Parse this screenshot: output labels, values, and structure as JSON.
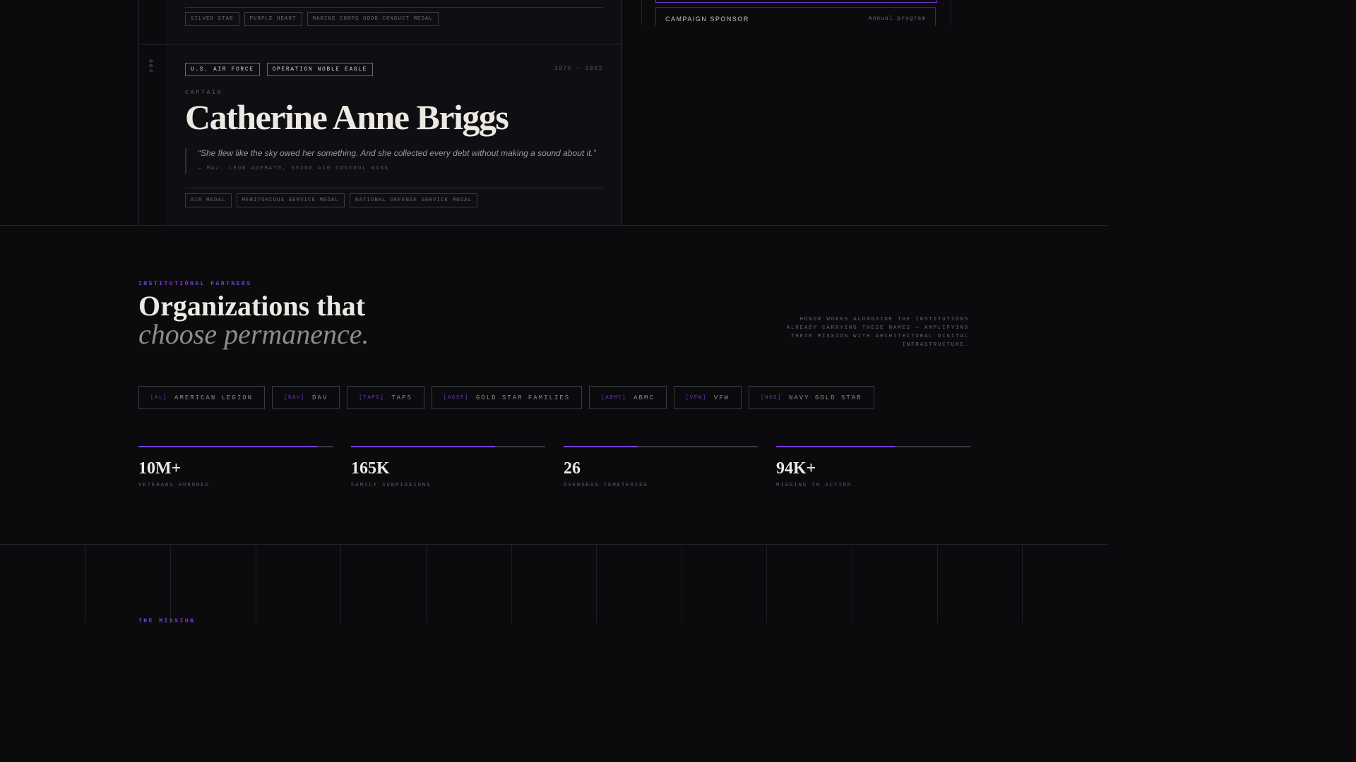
{
  "previous_card": {
    "medals": [
      "SILVER STAR",
      "PURPLE HEART",
      "MARINE CORPS GOOD CONDUCT MEDAL"
    ]
  },
  "sidebar": {
    "sponsor_label": "CAMPAIGN SPONSOR",
    "sponsor_note": "Annual program"
  },
  "memorial": {
    "index": "004",
    "branch": "U.S. AIR FORCE",
    "operation": "OPERATION NOBLE EAGLE",
    "years": "1975 — 2002",
    "rank": "CAPTAIN",
    "name": "Catherine Anne Briggs",
    "quote": "“She flew like the sky owed her something. And she collected every debt without making a sound about it.”",
    "attribution": "— MAJ. LEON ADEBAYO, 552ND AIR CONTROL WING",
    "medals": [
      "AIR MEDAL",
      "MERITORIOUS SERVICE MEDAL",
      "NATIONAL DEFENSE SERVICE MEDAL"
    ]
  },
  "partners": {
    "eyebrow": "INSTITUTIONAL PARTNERS",
    "headline_line1": "Organizations that",
    "headline_line2": "choose permanence.",
    "side_copy": "HONOR WORKS ALONGSIDE THE INSTITUTIONS ALREADY CARRYING THESE NAMES — AMPLIFYING THEIR MISSION WITH ARCHITECTURAL DIGITAL INFRASTRUCTURE.",
    "organizations": [
      {
        "abbr": "[AL]",
        "name": "AMERICAN LEGION"
      },
      {
        "abbr": "[DAV]",
        "name": "DAV"
      },
      {
        "abbr": "[TAPS]",
        "name": "TAPS"
      },
      {
        "abbr": "[AGSF]",
        "name": "GOLD STAR FAMILIES"
      },
      {
        "abbr": "[ABMC]",
        "name": "ABMC"
      },
      {
        "abbr": "[VFW]",
        "name": "VFW"
      },
      {
        "abbr": "[NGS]",
        "name": "NAVY GOLD STAR"
      }
    ],
    "stats": [
      {
        "value": "10M+",
        "label": "VETERANS HONORED",
        "progress": 0.92
      },
      {
        "value": "165K",
        "label": "FAMILY SUBMISSIONS",
        "progress": 0.74
      },
      {
        "value": "26",
        "label": "OVERSEAS CEMETERIES",
        "progress": 0.38
      },
      {
        "value": "94K+",
        "label": "MISSING IN ACTION",
        "progress": 0.61
      }
    ]
  },
  "mission": {
    "eyebrow": "THE MISSION"
  },
  "colors": {
    "accent": "#7a3ed6",
    "background": "#0b0b0e",
    "text": "#ece9e2"
  }
}
